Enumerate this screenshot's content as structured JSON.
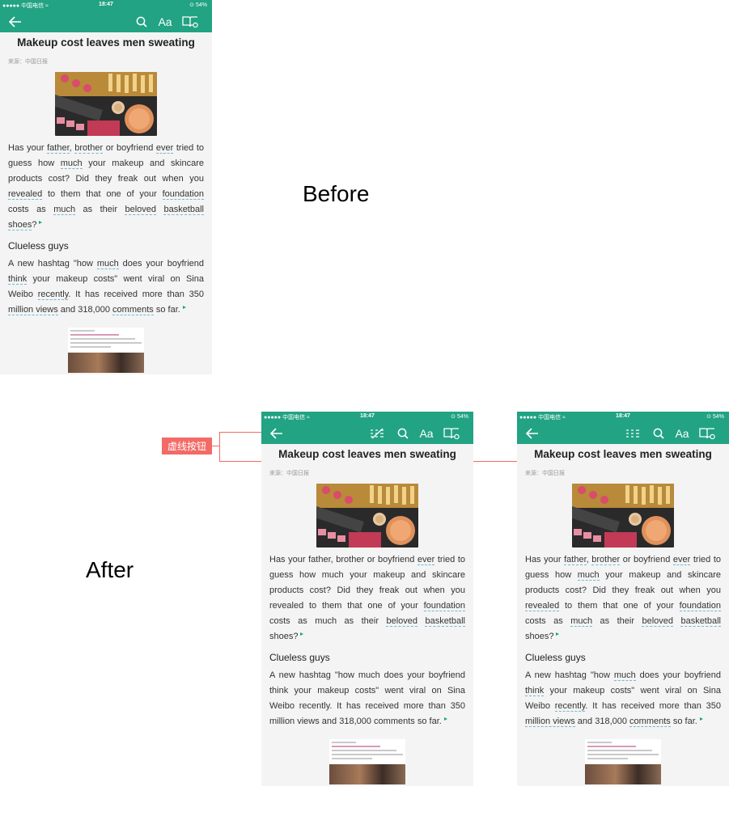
{
  "labels": {
    "before": "Before",
    "after": "After",
    "callout": "虚线按钮"
  },
  "colors": {
    "brand": "#22a383",
    "callout": "#f26b66"
  },
  "status_bar": {
    "carrier": "●●●●● 中国电信 ≈",
    "time": "18:47",
    "battery": "⊙ 54%"
  },
  "toolbar_icons": [
    "back-arrow-icon",
    "dashed-line-icon",
    "search-icon",
    "font-size-icon",
    "book-settings-icon"
  ],
  "article": {
    "title": "Makeup cost leaves men sweating",
    "source": "来源：中国日报",
    "p1_segments": [
      "Has your ",
      "father",
      ", ",
      "brother",
      " or boyfriend ",
      "ever",
      " tried to guess how ",
      "much",
      " your makeup and skincare products cost? Did they freak out when you ",
      "revealed",
      " to them that one of your ",
      "foundation",
      " costs as ",
      "much",
      " as their ",
      "beloved",
      " ",
      "basketball",
      " ",
      "shoes",
      "?"
    ],
    "subheading": "Clueless guys",
    "p2_segments": [
      "A new hashtag \"how ",
      "much",
      " does your boyfriend ",
      "think",
      " your makeup costs\" went viral on Sina Weibo ",
      "recently",
      ". It has received more than 350 ",
      "million views",
      " and 318,000 ",
      "comments",
      " so far."
    ]
  },
  "phones": [
    {
      "id": "before",
      "dashed_icon": false,
      "p1_underlines": [
        1,
        3,
        5,
        7,
        9,
        11,
        13,
        15,
        17,
        19
      ],
      "p2_underlines": [
        1,
        3,
        5,
        7,
        9
      ]
    },
    {
      "id": "after-1",
      "dashed_icon": true,
      "dashed_active": true,
      "p1_underlines": [
        5,
        11,
        15,
        17
      ],
      "p2_underlines": []
    },
    {
      "id": "after-2",
      "dashed_icon": true,
      "dashed_active": false,
      "p1_underlines": [
        1,
        3,
        5,
        7,
        9,
        11,
        13,
        15,
        17
      ],
      "p2_underlines": [
        1,
        3,
        5,
        7,
        9
      ]
    }
  ]
}
